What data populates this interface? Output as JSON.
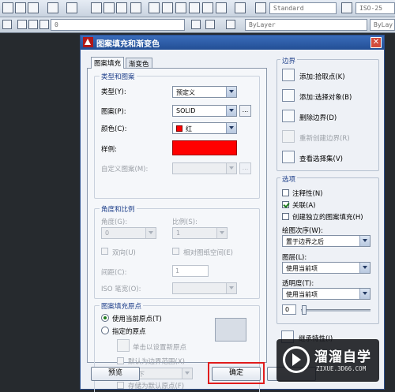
{
  "toolbar": {
    "text_style": "Standard",
    "dim_style": "ISO-25",
    "layer": "0",
    "color": "ByLayer",
    "linetype": "ByLay"
  },
  "dialog": {
    "title": "图案填充和渐变色",
    "close_glyph": "✕",
    "tabs": [
      "图案填充",
      "渐变色"
    ],
    "type_pattern": {
      "group_title": "类型和图案",
      "type_label": "类型(Y):",
      "type_value": "预定义",
      "pattern_label": "图案(P):",
      "pattern_value": "SOLID",
      "color_label": "颜色(C):",
      "color_value": "红",
      "color_hex": "#ff0000",
      "swatch_label": "样例:",
      "custom_label": "自定义图案(M):",
      "browse_glyph": "..."
    },
    "angle_scale": {
      "group_title": "角度和比例",
      "angle_label": "角度(G):",
      "angle_value": "0",
      "scale_label": "比例(S):",
      "scale_value": "1",
      "double_label": "双向(U)",
      "relative_label": "相对图纸空间(E)",
      "spacing_label": "间距(C):",
      "spacing_value": "1",
      "iso_label": "ISO 笔宽(O):"
    },
    "origin": {
      "group_title": "图案填充原点",
      "use_current": "使用当前原点(T)",
      "specified": "指定的原点",
      "click_set": "单击以设置新原点",
      "default_extent": "默认为边界范围(X)",
      "position_value": "左下",
      "store_default": "存储为默认原点(F)"
    },
    "boundaries": {
      "title": "边界",
      "add_pick": "添加:拾取点(K)",
      "add_select": "添加:选择对象(B)",
      "remove": "删除边界(D)",
      "recreate": "重新创建边界(R)",
      "view_selection": "查看选择集(V)"
    },
    "options": {
      "title": "选项",
      "annotative": "注释性(N)",
      "associative": "关联(A)",
      "separate": "创建独立的图案填充(H)",
      "draw_order_label": "绘图次序(W):",
      "draw_order_value": "置于边界之后",
      "layer_label": "图层(L):",
      "layer_value": "使用当前项",
      "transparency_label": "透明度(T):",
      "transparency_value": "使用当前项",
      "transparency_number": "0",
      "inherit": "继承特性(I)"
    },
    "preview_button": "预览",
    "ok_button": "确定"
  },
  "watermark": {
    "cn": "溜溜自学",
    "url": "ZIXUE.3D66.COM"
  }
}
